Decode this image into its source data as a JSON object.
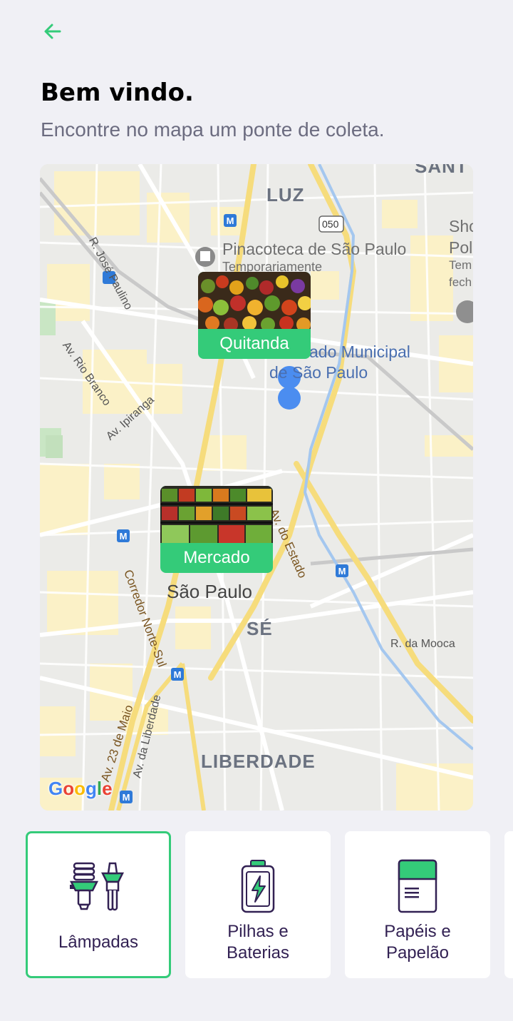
{
  "header": {
    "back_icon": "arrow-left-icon",
    "title": "Bem vindo.",
    "subtitle": "Encontre no mapa um ponte de coleta."
  },
  "colors": {
    "accent": "#34cb79",
    "title": "#000000",
    "subtitle": "#6c6c80",
    "item_text": "#322153",
    "background": "#f0f0f5"
  },
  "map": {
    "districts": [
      "LUZ",
      "SÉ",
      "LIBERDADE",
      "SANT"
    ],
    "city": "São Paulo",
    "pois": {
      "pinacoteca": "Pinacoteca de São Paulo",
      "pinacoteca_status": "Temporariamente",
      "mercado_a": "ado Municipal",
      "mercado_b": "de São Paulo",
      "shop_a": "Sho",
      "shop_b": "Pol",
      "shop_c": "Tem",
      "shop_d": "fech"
    },
    "streets": {
      "jose_paulino": "R. José Paulino",
      "rio_branco": "Av. Rio Branco",
      "ipiranga": "Av. Ipiranga",
      "estado": "Av. do Estado",
      "corredor": "Corredor Norte-Sul",
      "mooca": "R. da Mooca",
      "maio": "Av. 23 de Maio",
      "liberdade": "Av. da Liberdade"
    },
    "highway_shield": "050",
    "metro_symbol": "M",
    "attribution": "Google",
    "markers": [
      {
        "label": "Quitanda"
      },
      {
        "label": "Mercado"
      }
    ]
  },
  "items": [
    {
      "label": "Lâmpadas",
      "icon": "light-bulbs-icon",
      "selected": true
    },
    {
      "label": "Pilhas e Baterias",
      "icon": "battery-icon",
      "selected": false
    },
    {
      "label": "Papéis e Papelão",
      "icon": "paper-icon",
      "selected": false
    }
  ]
}
